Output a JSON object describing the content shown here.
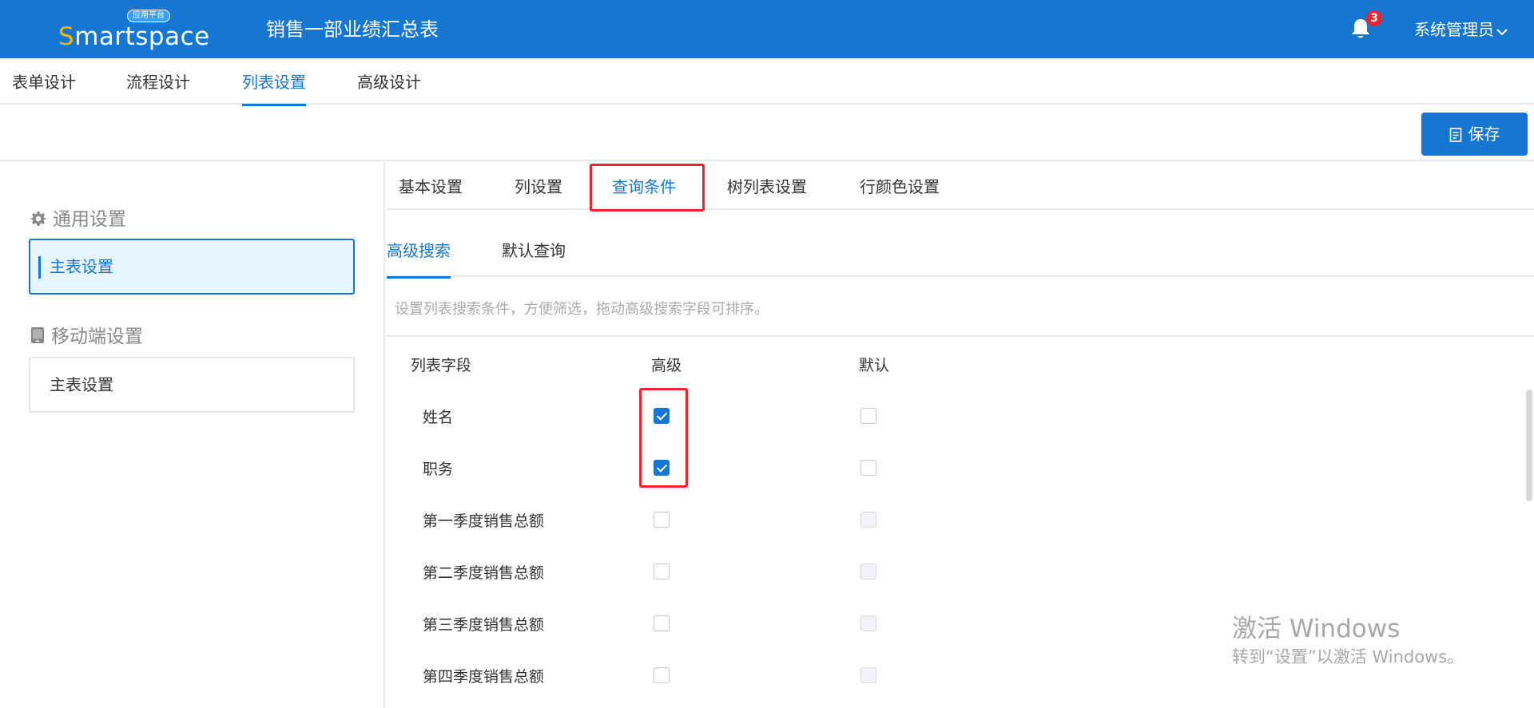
{
  "header": {
    "logo_badge": "应用平台",
    "logo_accent": "S",
    "logo_rest": "martspace",
    "title": "销售一部业绩汇总表",
    "notifications": "3",
    "user": "系统管理员"
  },
  "nav": {
    "tabs": [
      {
        "label": "表单设计"
      },
      {
        "label": "流程设计"
      },
      {
        "label": "列表设置"
      },
      {
        "label": "高级设计"
      }
    ],
    "active": "列表设置"
  },
  "toolbar": {
    "save_label": "保存"
  },
  "sidebar": {
    "groups": [
      {
        "label": "通用设置",
        "icon": "gear-icon",
        "items": [
          {
            "label": "主表设置",
            "active": true
          }
        ]
      },
      {
        "label": "移动端设置",
        "icon": "mobile-icon",
        "items": [
          {
            "label": "主表设置",
            "active": false
          }
        ]
      }
    ]
  },
  "content": {
    "tabs": [
      {
        "label": "基本设置"
      },
      {
        "label": "列设置"
      },
      {
        "label": "查询条件"
      },
      {
        "label": "树列表设置"
      },
      {
        "label": "行颜色设置"
      }
    ],
    "active_tab": "查询条件",
    "inner_tabs": [
      {
        "label": "高级搜索"
      },
      {
        "label": "默认查询"
      }
    ],
    "active_inner_tab": "高级搜索",
    "hint": "设置列表搜索条件，方便筛选，拖动高级搜索字段可排序。",
    "columns": [
      "列表字段",
      "高级",
      "默认"
    ],
    "rows": [
      {
        "field": "姓名",
        "advanced": true,
        "default": false,
        "default_disabled": false
      },
      {
        "field": "职务",
        "advanced": true,
        "default": false,
        "default_disabled": false
      },
      {
        "field": "第一季度销售总额",
        "advanced": false,
        "default": false,
        "default_disabled": true
      },
      {
        "field": "第二季度销售总额",
        "advanced": false,
        "default": false,
        "default_disabled": true
      },
      {
        "field": "第三季度销售总额",
        "advanced": false,
        "default": false,
        "default_disabled": true
      },
      {
        "field": "第四季度销售总额",
        "advanced": false,
        "default": false,
        "default_disabled": true
      }
    ]
  },
  "watermark": {
    "line1": "激活 Windows",
    "line2": "转到“设置”以激活 Windows。"
  },
  "colors": {
    "primary": "#1677d2",
    "highlight": "#f5222d",
    "badge": "#f5222d"
  }
}
